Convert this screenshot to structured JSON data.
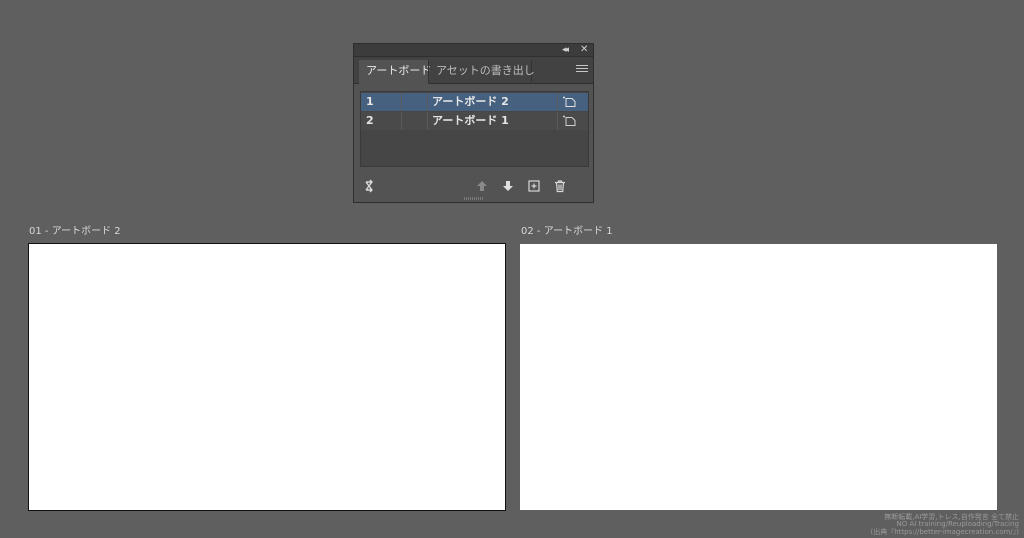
{
  "panel": {
    "tabs": [
      {
        "label": "アートボード",
        "active": true
      },
      {
        "label": "アセットの書き出し",
        "active": false
      }
    ],
    "rows": [
      {
        "number": "1",
        "name": "アートボード 2",
        "selected": true
      },
      {
        "number": "2",
        "name": "アートボード 1",
        "selected": false
      }
    ],
    "icons": {
      "collapse": "collapse-panel-icon",
      "close": "close-icon",
      "menu": "panel-menu-icon",
      "rearrange": "rearrange-artboards-icon",
      "move_up": "move-up-icon",
      "move_down": "move-down-icon",
      "new_artboard": "new-artboard-icon",
      "delete": "trash-icon",
      "artboard_options": "artboard-options-icon"
    }
  },
  "artboards": [
    {
      "label": "01 - アートボード 2",
      "selected": true
    },
    {
      "label": "02 - アートボード 1",
      "selected": false
    }
  ],
  "watermark": {
    "lines": [
      "無断転載,AI学習,トレス,自作発言 全て禁止",
      "NO AI training/Reuploading/Tracing",
      "(出典『https://better-imagecreation.com/』)"
    ]
  },
  "colors": {
    "canvas": "#5f5f5f",
    "panel_bg": "#535353",
    "selected_row": "#46607f"
  }
}
